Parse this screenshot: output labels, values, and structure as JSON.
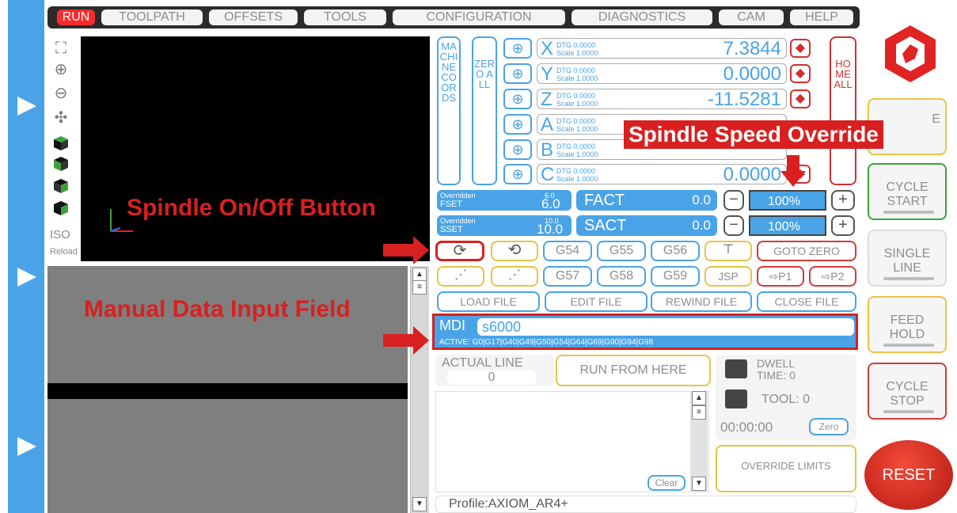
{
  "tabs": [
    "RUN",
    "TOOLPATH",
    "OFFSETS",
    "TOOLS",
    "CONFIGURATION",
    "DIAGNOSTICS",
    "CAM",
    "HELP"
  ],
  "left_tools": {
    "iso_label": "ISO",
    "reload_label": "Reload"
  },
  "dro": {
    "machine_coords_label": "MACHINE COORDS",
    "zero_all_label": "ZERO ALL",
    "home_label": "HOME ALL",
    "axes": [
      {
        "letter": "X",
        "dtg": "DTG 0.0000",
        "scale": "Scale 1.0000",
        "value": "7.3844"
      },
      {
        "letter": "Y",
        "dtg": "DTG 0.0000",
        "scale": "Scale 1.0000",
        "value": "0.0000"
      },
      {
        "letter": "Z",
        "dtg": "DTG 0.0000",
        "scale": "Scale 1.0000",
        "value": "-11.5281"
      },
      {
        "letter": "A",
        "dtg": "DTG 0.0000",
        "scale": "Scale 1.0000",
        "value": ""
      },
      {
        "letter": "B",
        "dtg": "DTG 0.0000",
        "scale": "Scale 1.0000",
        "value": ""
      },
      {
        "letter": "C",
        "dtg": "DTG 0.0000",
        "scale": "Scale 1.0000",
        "value": "0.0000"
      }
    ]
  },
  "feed": {
    "overridden_label": "Overridden",
    "fset_label": "FSET",
    "fset_top": "6.0",
    "fset_val": "6.0",
    "fact_label": "FACT",
    "fact_val": "0.0",
    "fact_pct": "100%",
    "sset_label": "SSET",
    "sset_top": "10.0",
    "sset_val": "10.0",
    "sact_label": "SACT",
    "sact_val": "0.0",
    "sact_pct": "100%"
  },
  "work_offsets": [
    "G54",
    "G55",
    "G56",
    "G57",
    "G58",
    "G59"
  ],
  "buttons": {
    "goto_zero": "GOTO ZERO",
    "jsp": "JSP",
    "p1": "⇨P1",
    "p2": "⇨P2",
    "load_file": "LOAD FILE",
    "edit_file": "EDIT FILE",
    "rewind_file": "REWIND FILE",
    "close_file": "CLOSE FILE",
    "run_from_here": "RUN FROM HERE",
    "clear": "Clear",
    "zero_timer": "Zero",
    "override_limits": "OVERRIDE LIMITS"
  },
  "mdi": {
    "label": "MDI",
    "value": "s6000",
    "active": "ACTIVE: G0|G17|G40|G49|G50|G54|G64|G69|G90|G94|G98"
  },
  "status": {
    "actual_line_label": "ACTUAL LINE",
    "actual_line_value": "0",
    "dwell_label": "DWELL",
    "time_label": "TIME: 0",
    "tool_label": "TOOL: 0",
    "timer": "00:00:00",
    "profile": "Profile:AXIOM_AR4+"
  },
  "right_buttons": {
    "top": "E",
    "cycle_start": "CYCLE START",
    "single_line": "SINGLE LINE",
    "feed_hold": "FEED HOLD",
    "cycle_stop": "CYCLE STOP",
    "reset": "RESET"
  },
  "annotations": {
    "spindle_speed_override": "Spindle Speed Override",
    "spindle_on_off": "Spindle On/Off Button",
    "mdi_field": "Manual Data Input Field"
  },
  "colors": {
    "accent": "#4aa3e6",
    "alert": "#d82020",
    "reset": "#d92a1c",
    "tab_active": "#ff2a2a"
  }
}
